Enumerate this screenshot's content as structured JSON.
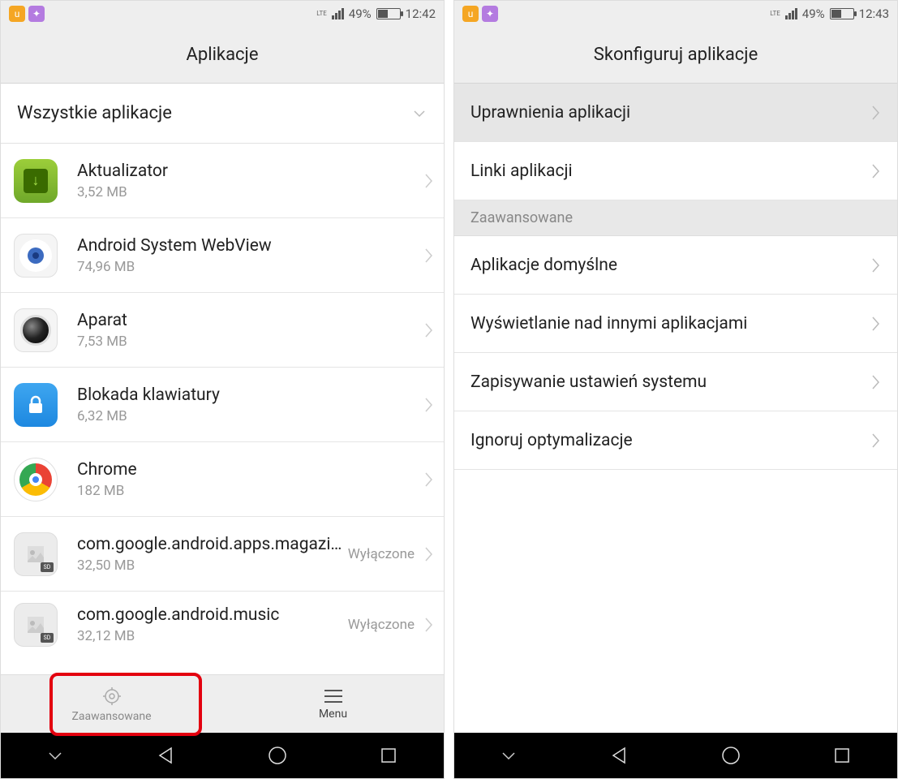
{
  "left": {
    "statusbar": {
      "battery_pct": "49%",
      "time": "12:42"
    },
    "header_title": "Aplikacje",
    "dropdown_label": "Wszystkie aplikacje",
    "apps": [
      {
        "name": "Aktualizator",
        "size": "3,52 MB",
        "status": ""
      },
      {
        "name": "Android System WebView",
        "size": "74,96 MB",
        "status": ""
      },
      {
        "name": "Aparat",
        "size": "7,53 MB",
        "status": ""
      },
      {
        "name": "Blokada klawiatury",
        "size": "6,32 MB",
        "status": ""
      },
      {
        "name": "Chrome",
        "size": "182 MB",
        "status": ""
      },
      {
        "name": "com.google.android.apps.magazi…",
        "size": "32,50 MB",
        "status": "Wyłączone"
      },
      {
        "name": "com.google.android.music",
        "size": "32,12 MB",
        "status": "Wyłączone"
      }
    ],
    "actionbar": {
      "advanced_label": "Zaawansowane",
      "menu_label": "Menu"
    }
  },
  "right": {
    "statusbar": {
      "battery_pct": "49%",
      "time": "12:43"
    },
    "header_title": "Skonfiguruj aplikacje",
    "items": [
      {
        "label": "Uprawnienia aplikacji",
        "highlight": true
      },
      {
        "label": "Linki aplikacji",
        "highlight": false
      }
    ],
    "section_label": "Zaawansowane",
    "items2": [
      {
        "label": "Aplikacje domyślne"
      },
      {
        "label": "Wyświetlanie nad innymi aplikacjami"
      },
      {
        "label": "Zapisywanie ustawień systemu"
      },
      {
        "label": "Ignoruj optymalizacje"
      }
    ]
  }
}
